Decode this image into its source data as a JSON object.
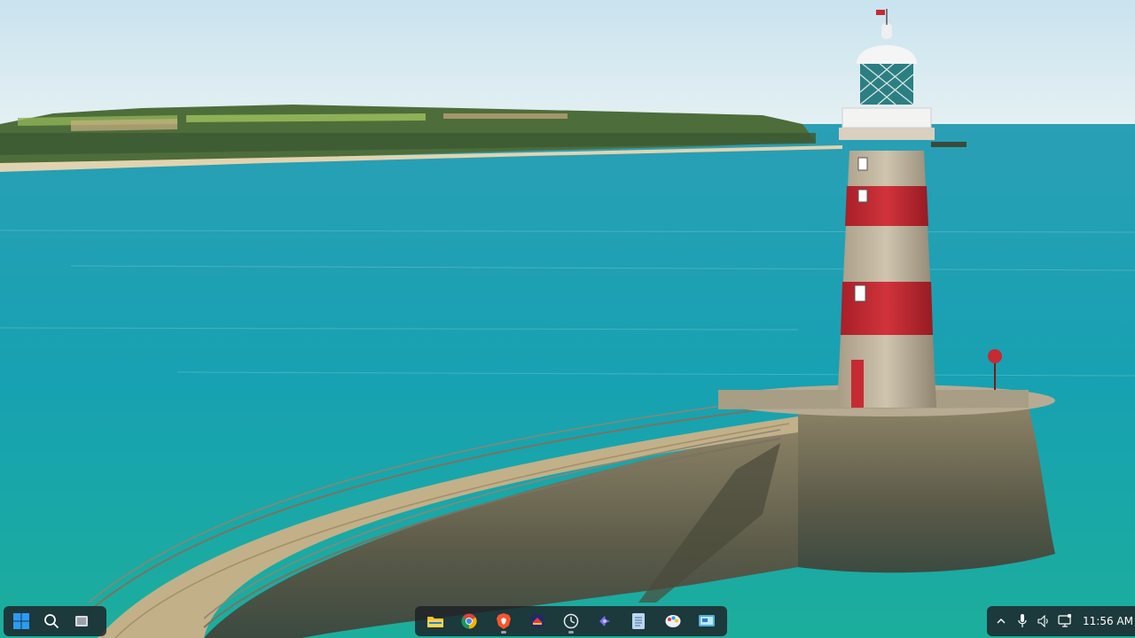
{
  "desktop": {
    "wallpaper_subject": "lighthouse-on-pier",
    "colors": {
      "sky": "#dfeef4",
      "sea": "#1aa3b4",
      "lighthouse_red": "#c62a33",
      "stone": "#b8ab93"
    }
  },
  "taskbar": {
    "left": [
      {
        "name": "start-icon"
      },
      {
        "name": "search-icon"
      },
      {
        "name": "task-view-icon"
      }
    ],
    "apps": [
      {
        "name": "file-explorer-icon"
      },
      {
        "name": "chrome-icon"
      },
      {
        "name": "brave-icon",
        "running": true
      },
      {
        "name": "app-icon"
      },
      {
        "name": "clock-app-icon",
        "running": true
      },
      {
        "name": "tool-icon"
      },
      {
        "name": "notepad-icon"
      },
      {
        "name": "paint-icon"
      },
      {
        "name": "screen-icon"
      }
    ],
    "tray": {
      "icons": [
        "chevron-up-icon",
        "microphone-icon",
        "volume-icon",
        "display-icon"
      ],
      "time": "11:56 AM"
    }
  }
}
